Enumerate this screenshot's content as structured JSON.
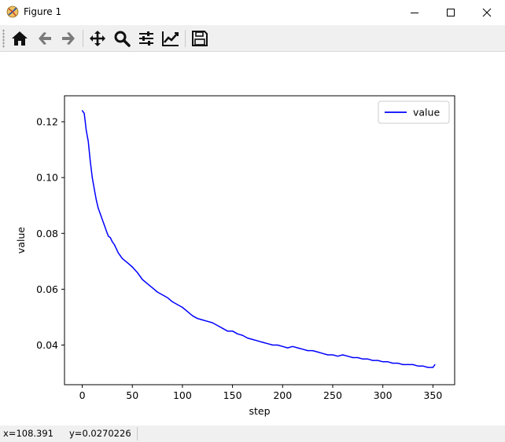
{
  "window": {
    "title": "Figure 1",
    "controls": [
      "minimize",
      "maximize",
      "close"
    ]
  },
  "toolbar": {
    "buttons": [
      {
        "name": "home",
        "icon": "home-icon"
      },
      {
        "name": "back",
        "icon": "arrow-left-icon"
      },
      {
        "name": "forward",
        "icon": "arrow-right-icon"
      },
      {
        "name": "pan",
        "icon": "move-icon"
      },
      {
        "name": "zoom",
        "icon": "magnifier-icon"
      },
      {
        "name": "configure-subplots",
        "icon": "sliders-icon"
      },
      {
        "name": "edit-axis",
        "icon": "line-chart-icon"
      },
      {
        "name": "save",
        "icon": "floppy-disk-icon"
      }
    ]
  },
  "status": {
    "x": "x=108.391",
    "y": "y=0.0270226"
  },
  "chart_data": {
    "type": "line",
    "title": "",
    "xlabel": "step",
    "ylabel": "value",
    "xlim": [
      -17.7,
      371.7
    ],
    "ylim": [
      0.0258,
      0.1293
    ],
    "xticks": [
      0,
      50,
      100,
      150,
      200,
      250,
      300,
      350
    ],
    "xtick_labels": [
      "0",
      "50",
      "100",
      "150",
      "200",
      "250",
      "300",
      "350"
    ],
    "yticks": [
      0.04,
      0.06,
      0.08,
      0.1,
      0.12
    ],
    "ytick_labels": [
      "0.04",
      "0.06",
      "0.08",
      "0.10",
      "0.12"
    ],
    "grid": false,
    "legend": {
      "position": "upper right",
      "entries": [
        "value"
      ]
    },
    "series": [
      {
        "name": "value",
        "color": "#0000ff",
        "x": [
          0,
          2,
          4,
          6,
          8,
          10,
          12,
          14,
          16,
          18,
          20,
          22,
          24,
          26,
          28,
          30,
          32,
          34,
          36,
          38,
          40,
          45,
          50,
          55,
          60,
          65,
          70,
          75,
          80,
          85,
          90,
          95,
          100,
          105,
          110,
          115,
          120,
          125,
          130,
          135,
          140,
          145,
          150,
          155,
          160,
          165,
          170,
          175,
          180,
          185,
          190,
          195,
          200,
          205,
          210,
          215,
          220,
          225,
          230,
          235,
          240,
          245,
          250,
          255,
          260,
          265,
          270,
          275,
          280,
          285,
          290,
          295,
          300,
          305,
          310,
          315,
          320,
          325,
          330,
          335,
          340,
          345,
          350,
          352
        ],
        "values": [
          0.124,
          0.123,
          0.117,
          0.113,
          0.106,
          0.1,
          0.096,
          0.092,
          0.089,
          0.087,
          0.085,
          0.083,
          0.081,
          0.079,
          0.0785,
          0.077,
          0.076,
          0.0745,
          0.073,
          0.072,
          0.071,
          0.0695,
          0.068,
          0.066,
          0.0635,
          0.062,
          0.0605,
          0.059,
          0.058,
          0.057,
          0.0555,
          0.0545,
          0.0535,
          0.052,
          0.0505,
          0.0495,
          0.049,
          0.0485,
          0.048,
          0.047,
          0.046,
          0.045,
          0.045,
          0.044,
          0.0435,
          0.0425,
          0.042,
          0.0415,
          0.041,
          0.0405,
          0.04,
          0.04,
          0.0395,
          0.039,
          0.0395,
          0.039,
          0.0385,
          0.038,
          0.038,
          0.0375,
          0.037,
          0.0365,
          0.0365,
          0.036,
          0.0365,
          0.036,
          0.0355,
          0.0355,
          0.035,
          0.035,
          0.0345,
          0.0345,
          0.034,
          0.034,
          0.0335,
          0.0335,
          0.033,
          0.033,
          0.033,
          0.0325,
          0.0325,
          0.032,
          0.032,
          0.033
        ]
      }
    ]
  }
}
